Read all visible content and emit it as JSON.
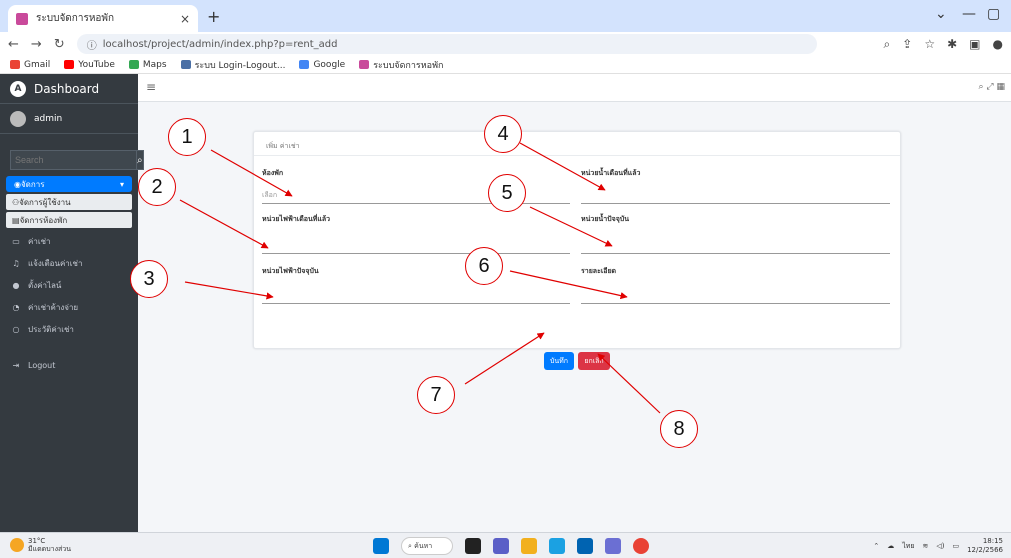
{
  "browser": {
    "tab_title": "ระบบจัดการหอพัก",
    "tab_close": "×",
    "new_tab": "+",
    "url": "localhost/project/admin/index.php?p=rent_add",
    "bookmarks": [
      "Gmail",
      "YouTube",
      "Maps",
      "ระบบ Login-Logout...",
      "Google",
      "ระบบจัดการหอพัก"
    ]
  },
  "sidebar": {
    "brand": "Dashboard",
    "user": "admin",
    "search_placeholder": "Search",
    "active_menu": "จัดการ",
    "submenu": [
      "จัดการผู้ใช้งาน",
      "จัดการห้องพัก"
    ],
    "menu": [
      "ค่าเช่า",
      "แจ้งเตือนค่าเช่า",
      "ตั้งค่าไลน์",
      "ค่าเช่าค้างจ่าย",
      "ประวัติค่าเช่า"
    ],
    "logout": "Logout"
  },
  "form": {
    "header": "เพิ่ม ค่าเช่า",
    "room_label": "ห้องพัก",
    "room_value": "เลือก",
    "water_prev_label": "หน่วยน้ำเดือนที่แล้ว",
    "elec_prev_label": "หน่วยไฟฟ้าเดือนที่แล้ว",
    "water_now_label": "หน่วยน้ำปัจจุบัน",
    "elec_now_label": "หน่วยไฟฟ้าปัจจุบัน",
    "detail_label": "รายละเอียด",
    "save_label": "บันทึก",
    "cancel_label": "ยกเลิก"
  },
  "annotations": [
    "1",
    "2",
    "3",
    "4",
    "5",
    "6",
    "7",
    "8"
  ],
  "taskbar": {
    "temperature": "31°C",
    "weather": "มีแดดบางส่วน",
    "search": "ค้นหา",
    "lang": "ไทย",
    "time": "18:15",
    "date": "12/2/2566"
  },
  "colors": {
    "annotation": "#e00000",
    "primary": "#007bff",
    "danger": "#dc3545",
    "sidebar": "#343a40"
  }
}
